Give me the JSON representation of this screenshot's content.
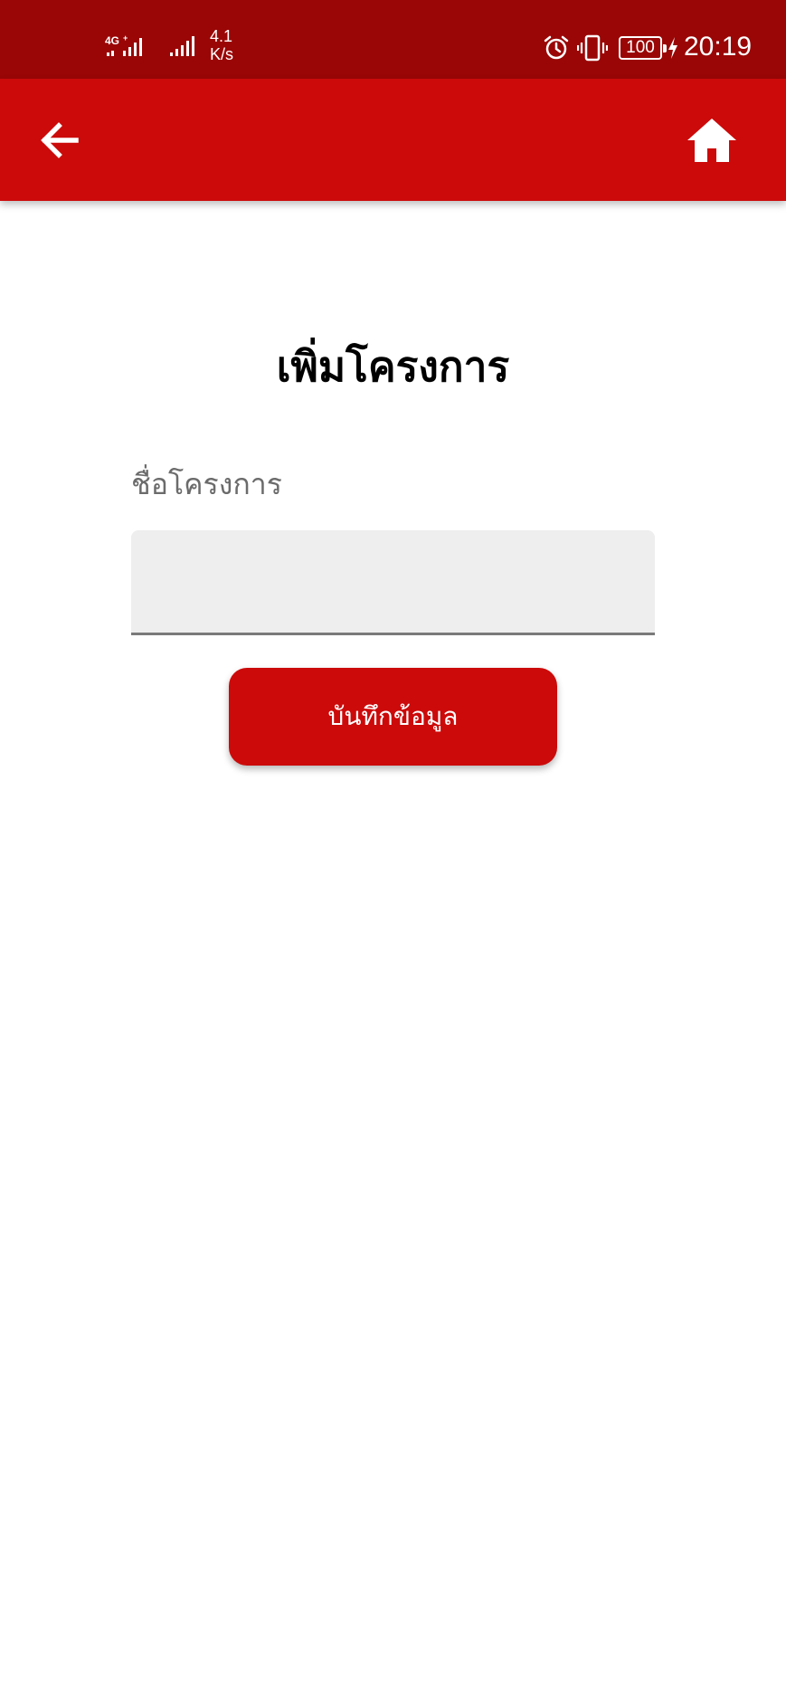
{
  "status_bar": {
    "network_label": "4G",
    "speed_value": "4.1",
    "speed_unit": "K/s",
    "battery": "100",
    "time": "20:19"
  },
  "app_bar": {
    "back_icon": "arrow-left-icon",
    "home_icon": "home-icon"
  },
  "page": {
    "title": "เพิ่มโครงการ",
    "field_label": "ชื่อโครงการ",
    "field_value": "",
    "field_placeholder": "",
    "save_label": "บันทึกข้อมูล"
  },
  "colors": {
    "status_bar": "#9a0606",
    "app_bar": "#cc0a0a",
    "accent": "#cc0a0a",
    "input_bg": "#eeeeee"
  }
}
